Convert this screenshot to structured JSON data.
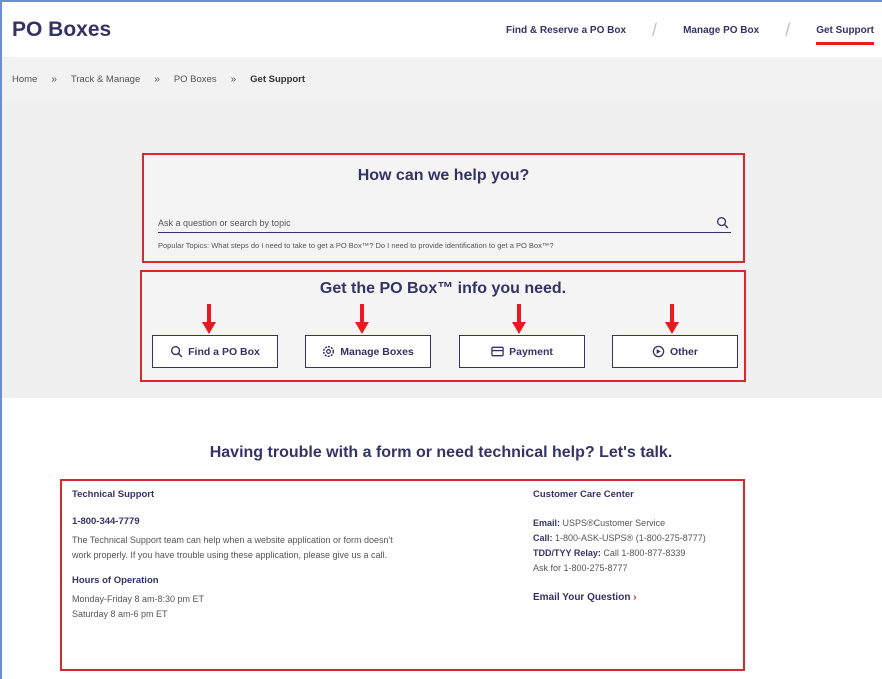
{
  "header": {
    "title": "PO Boxes",
    "nav": [
      "Find & Reserve a PO Box",
      "Manage PO Box",
      "Get Support"
    ]
  },
  "breadcrumb": [
    "Home",
    "Track & Manage",
    "PO Boxes",
    "Get Support"
  ],
  "help": {
    "title": "How can we help you?",
    "search_placeholder": "Ask a question or search by topic",
    "popular": "Popular Topics: What steps do I need to take to get a PO Box™? Do I need to provide identification to get a PO Box™?"
  },
  "info": {
    "title": "Get the PO Box™ info you need.",
    "buttons": [
      "Find a PO Box",
      "Manage Boxes",
      "Payment",
      "Other"
    ]
  },
  "trouble_heading": "Having trouble with a form or need technical help? Let's talk.",
  "tech": {
    "heading": "Technical Support",
    "phone": "1-800-344-7779",
    "desc": "The Technical Support team can help when a website application or form doesn't work properly. If you have trouble using these application, please give us a call.",
    "hours_heading": "Hours of Operation",
    "hours_1": "Monday-Friday 8 am-8:30 pm ET",
    "hours_2": "Saturday 8 am-6 pm ET"
  },
  "care": {
    "heading": "Customer Care Center",
    "email_label": "Email:",
    "email_value": "USPS®Customer Service",
    "call_label": "Call:",
    "call_value": "1-800-ASK-USPS® (1-800-275-8777)",
    "tdd_label": "TDD/TYY Relay:",
    "tdd_value": "Call 1-800-877-8339",
    "ask": "Ask for 1-800-275-8777",
    "email_question": "Email Your Question",
    "chevron": "›"
  },
  "colors": {
    "accent": "#d7282f",
    "brand": "#333366"
  }
}
